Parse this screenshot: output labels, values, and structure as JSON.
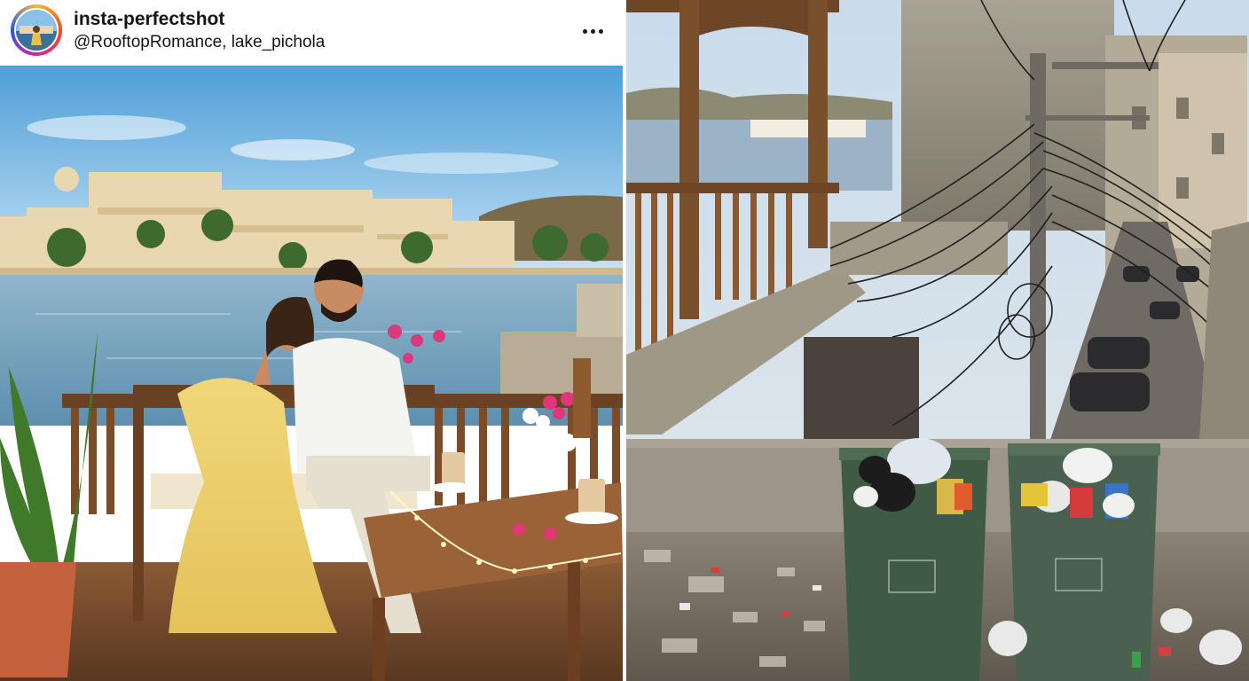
{
  "post": {
    "username": "insta-perfectshot",
    "location": "@RooftopRomance, lake_pichola"
  },
  "icons": {
    "more": "more-horizontal-icon",
    "avatar": "profile-avatar"
  },
  "colors": {
    "story_ring_from": "#f7b733",
    "story_ring_to": "#d6249f",
    "text": "#151515"
  }
}
